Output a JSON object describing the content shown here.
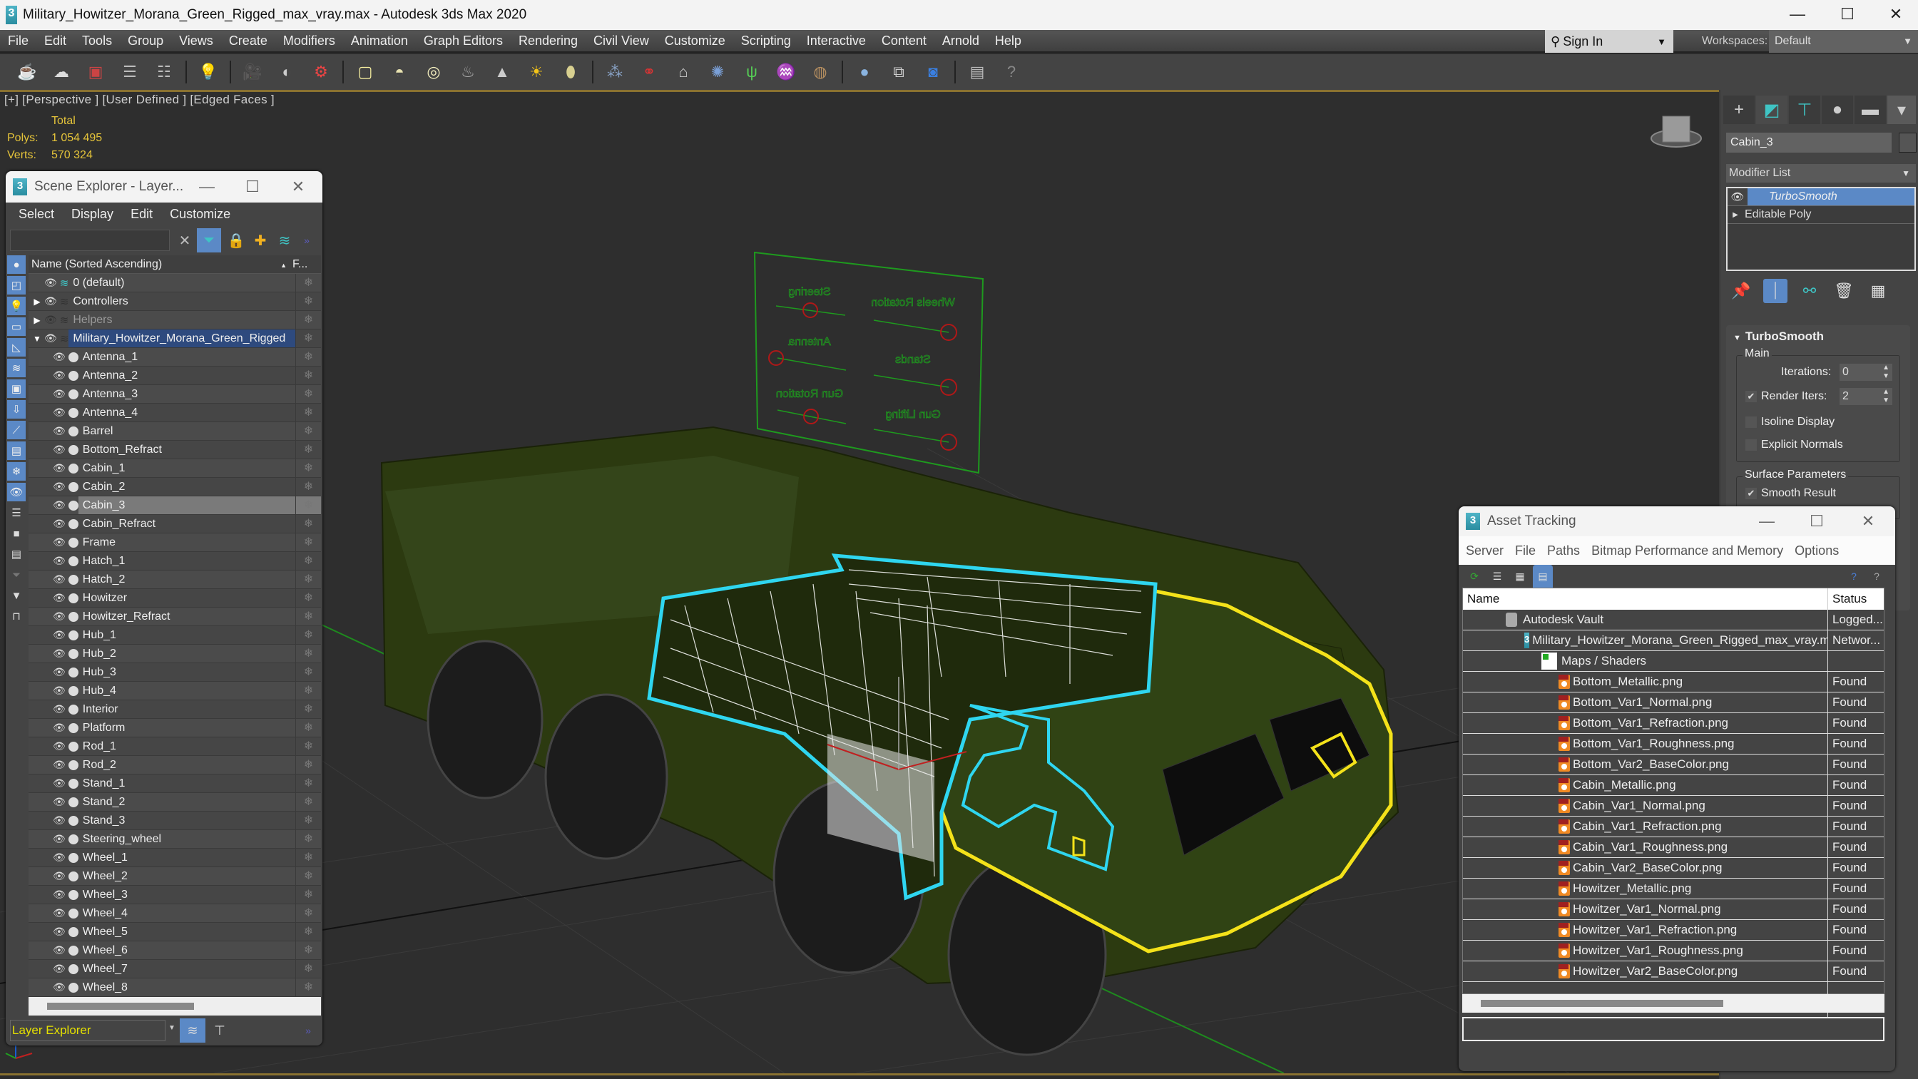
{
  "window": {
    "title": "Military_Howitzer_Morana_Green_Rigged_max_vray.max - Autodesk 3ds Max 2020",
    "app_icon": "3",
    "controls": {
      "minimize": "—",
      "maximize": "☐",
      "close": "✕"
    }
  },
  "menubar": {
    "items": [
      "File",
      "Edit",
      "Tools",
      "Group",
      "Views",
      "Create",
      "Modifiers",
      "Animation",
      "Graph Editors",
      "Rendering",
      "Civil View",
      "Customize",
      "Scripting",
      "Interactive",
      "Content",
      "Arnold",
      "Help"
    ],
    "sign_in": "Sign In",
    "workspaces_label": "Workspaces:",
    "workspace_value": "Default"
  },
  "toolbar": {
    "icons": [
      "teapot-icon",
      "cloud-icon",
      "render-frame-icon",
      "render-setup-icon",
      "render-settings-icon",
      "light-lister-icon",
      "camera-icon",
      "physical-camera-icon",
      "target-camera-icon",
      "plane-light-icon",
      "dome-light-icon",
      "sphere-light-icon",
      "mesh-light-icon",
      "spot-light-icon",
      "sun-icon",
      "ies-light-icon",
      "vray-fur-icon",
      "vray-proxy-icon",
      "vray-plane-icon",
      "vray-displacement-icon",
      "vray-grass-icon",
      "vray-hair-icon",
      "vray-ox-icon",
      "vray-material-icon",
      "vray-asset-icon",
      "vray-frame-buffer-icon",
      "vray-log-icon",
      "help-icon"
    ]
  },
  "viewport": {
    "label": "[+] [Perspective ] [User Defined ] [Edged Faces ]",
    "stats": {
      "header": "Total",
      "polys_label": "Polys:",
      "polys_value": "1 054 495",
      "verts_label": "Verts:",
      "verts_value": "570 324"
    },
    "control_board_labels": [
      "Steering",
      "Wheels Rotation",
      "Antenna",
      "Stands",
      "Gun Rotation",
      "Gun Lifting"
    ],
    "colors": {
      "selection_cyan": "#2fd6f0",
      "selection_yellow": "#f4e21a",
      "vehicle_green": "#2f3f12",
      "control_green": "#1e9a1e",
      "control_handle_red": "#b01818"
    }
  },
  "scene_explorer": {
    "title": "Scene Explorer - Layer...",
    "menu": [
      "Select",
      "Display",
      "Edit",
      "Customize"
    ],
    "column_name": "Name (Sorted Ascending)",
    "column_freeze": "F...",
    "layers": [
      {
        "name": "0 (default)",
        "state": "default"
      },
      {
        "name": "Controllers",
        "state": "collapsed"
      },
      {
        "name": "Helpers",
        "state": "hidden"
      },
      {
        "name": "Military_Howitzer_Morana_Green_Rigged",
        "state": "expanded-selected"
      }
    ],
    "objects": [
      "Antenna_1",
      "Antenna_2",
      "Antenna_3",
      "Antenna_4",
      "Barrel",
      "Bottom_Refract",
      "Cabin_1",
      "Cabin_2",
      "Cabin_3",
      "Cabin_Refract",
      "Frame",
      "Hatch_1",
      "Hatch_2",
      "Howitzer",
      "Howitzer_Refract",
      "Hub_1",
      "Hub_2",
      "Hub_3",
      "Hub_4",
      "Interior",
      "Platform",
      "Rod_1",
      "Rod_2",
      "Stand_1",
      "Stand_2",
      "Stand_3",
      "Steering_wheel",
      "Wheel_1",
      "Wheel_2",
      "Wheel_3",
      "Wheel_4",
      "Wheel_5",
      "Wheel_6",
      "Wheel_7",
      "Wheel_8"
    ],
    "highlighted_object": "Cabin_3",
    "footer_mode": "Layer Explorer"
  },
  "command_panel": {
    "object_name": "Cabin_3",
    "modifier_list_label": "Modifier List",
    "stack": [
      "TurboSmooth",
      "Editable Poly"
    ],
    "rollout": {
      "title": "TurboSmooth",
      "group_main": "Main",
      "iterations_label": "Iterations:",
      "iterations_value": "0",
      "render_iters_label": "Render Iters:",
      "render_iters_value": "2",
      "render_iters_checked": true,
      "isoline_label": "Isoline Display",
      "isoline_checked": false,
      "explicit_normals_label": "Explicit Normals",
      "explicit_normals_checked": false,
      "group_surface": "Surface Parameters",
      "smooth_result_label": "Smooth Result",
      "smooth_result_checked": true
    }
  },
  "asset_tracking": {
    "title": "Asset Tracking",
    "menu": [
      "Server",
      "File",
      "Paths",
      "Bitmap Performance and Memory",
      "Options"
    ],
    "columns": {
      "name": "Name",
      "status": "Status"
    },
    "rows": [
      {
        "name": "Autodesk Vault",
        "status": "Logged...",
        "type": "vault",
        "level": 0
      },
      {
        "name": "Military_Howitzer_Morana_Green_Rigged_max_vray.max",
        "status": "Networ...",
        "type": "max",
        "level": 1
      },
      {
        "name": "Maps / Shaders",
        "status": "",
        "type": "folder",
        "level": 2
      },
      {
        "name": "Bottom_Metallic.png",
        "status": "Found",
        "type": "file",
        "level": 3
      },
      {
        "name": "Bottom_Var1_Normal.png",
        "status": "Found",
        "type": "file",
        "level": 3
      },
      {
        "name": "Bottom_Var1_Refraction.png",
        "status": "Found",
        "type": "file",
        "level": 3
      },
      {
        "name": "Bottom_Var1_Roughness.png",
        "status": "Found",
        "type": "file",
        "level": 3
      },
      {
        "name": "Bottom_Var2_BaseColor.png",
        "status": "Found",
        "type": "file",
        "level": 3
      },
      {
        "name": "Cabin_Metallic.png",
        "status": "Found",
        "type": "file",
        "level": 3
      },
      {
        "name": "Cabin_Var1_Normal.png",
        "status": "Found",
        "type": "file",
        "level": 3
      },
      {
        "name": "Cabin_Var1_Refraction.png",
        "status": "Found",
        "type": "file",
        "level": 3
      },
      {
        "name": "Cabin_Var1_Roughness.png",
        "status": "Found",
        "type": "file",
        "level": 3
      },
      {
        "name": "Cabin_Var2_BaseColor.png",
        "status": "Found",
        "type": "file",
        "level": 3
      },
      {
        "name": "Howitzer_Metallic.png",
        "status": "Found",
        "type": "file",
        "level": 3
      },
      {
        "name": "Howitzer_Var1_Normal.png",
        "status": "Found",
        "type": "file",
        "level": 3
      },
      {
        "name": "Howitzer_Var1_Refraction.png",
        "status": "Found",
        "type": "file",
        "level": 3
      },
      {
        "name": "Howitzer_Var1_Roughness.png",
        "status": "Found",
        "type": "file",
        "level": 3
      },
      {
        "name": "Howitzer_Var2_BaseColor.png",
        "status": "Found",
        "type": "file",
        "level": 3
      }
    ]
  }
}
